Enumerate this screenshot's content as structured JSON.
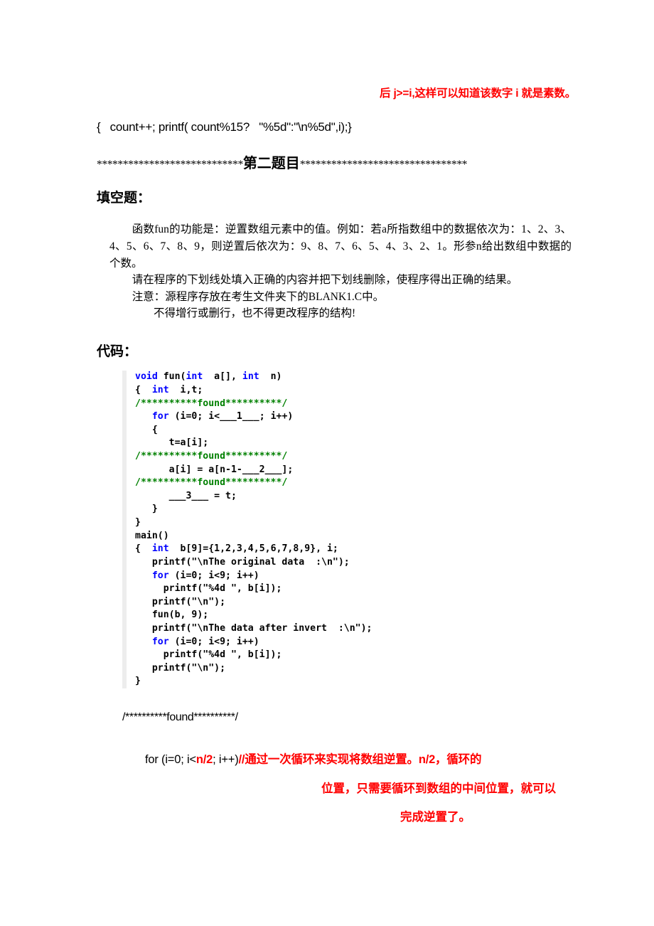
{
  "document": {
    "top_annotation": "后 j>=i,这样可以知道该数字 i 就是素数。",
    "leftover_code_line": "{   count++; printf( count%15?   \"%5d\":\"\\n%5d\",i);}",
    "divider": {
      "stars_left": "****************************",
      "title": "第二题目",
      "stars_right": "********************************"
    },
    "section_fill_heading": "填空题：",
    "description": {
      "p1": "函数fun的功能是：逆置数组元素中的值。例如：若a所指数组中的数据依次为：1、2、3、4、5、6、7、8、9，则逆置后依次为：9、8、7、6、5、4、3、2、1。形参n给出数组中数据的个数。",
      "p2": "请在程序的下划线处填入正确的内容并把下划线删除，使程序得出正确的结果。",
      "p3": "注意：源程序存放在考生文件夹下的BLANK1.C中。",
      "p4": "不得增行或删行，也不得更改程序的结构!"
    },
    "section_code_heading": "代码：",
    "code": {
      "lines": [
        [
          {
            "t": "void",
            "c": "kw"
          },
          {
            "t": " fun(",
            "c": ""
          },
          {
            "t": "int",
            "c": "kw"
          },
          {
            "t": "  a[], ",
            "c": ""
          },
          {
            "t": "int",
            "c": "kw"
          },
          {
            "t": "  n)",
            "c": ""
          }
        ],
        [
          {
            "t": "{  ",
            "c": ""
          },
          {
            "t": "int",
            "c": "kw"
          },
          {
            "t": "  i,t;",
            "c": ""
          }
        ],
        [
          {
            "t": "/**********found**********/",
            "c": "cmt"
          }
        ],
        [
          {
            "t": "   ",
            "c": ""
          },
          {
            "t": "for",
            "c": "kw"
          },
          {
            "t": " (i=0; i<___1___; i++)",
            "c": ""
          }
        ],
        [
          {
            "t": "   {",
            "c": ""
          }
        ],
        [
          {
            "t": "      t=a[i];",
            "c": ""
          }
        ],
        [
          {
            "t": "/**********found**********/",
            "c": "cmt"
          }
        ],
        [
          {
            "t": "      a[i] = a[n-1-___2___];",
            "c": ""
          }
        ],
        [
          {
            "t": "/**********found**********/",
            "c": "cmt"
          }
        ],
        [
          {
            "t": "      ___3___ = t;",
            "c": ""
          }
        ],
        [
          {
            "t": "   }",
            "c": ""
          }
        ],
        [
          {
            "t": "}",
            "c": ""
          }
        ],
        [
          {
            "t": "main()",
            "c": ""
          }
        ],
        [
          {
            "t": "{  ",
            "c": ""
          },
          {
            "t": "int",
            "c": "kw"
          },
          {
            "t": "  b[9]={1,2,3,4,5,6,7,8,9}, i;",
            "c": ""
          }
        ],
        [
          {
            "t": "   printf(\"\\nThe original data  :\\n\");",
            "c": ""
          }
        ],
        [
          {
            "t": "   ",
            "c": ""
          },
          {
            "t": "for",
            "c": "kw"
          },
          {
            "t": " (i=0; i<9; i++)",
            "c": ""
          }
        ],
        [
          {
            "t": "     printf(\"%4d \", b[i]);",
            "c": ""
          }
        ],
        [
          {
            "t": "   printf(\"\\n\");",
            "c": ""
          }
        ],
        [
          {
            "t": "   fun(b, 9);",
            "c": ""
          }
        ],
        [
          {
            "t": "   printf(\"\\nThe data after invert  :\\n\");",
            "c": ""
          }
        ],
        [
          {
            "t": "   ",
            "c": ""
          },
          {
            "t": "for",
            "c": "kw"
          },
          {
            "t": " (i=0; i<9; i++)",
            "c": ""
          }
        ],
        [
          {
            "t": "     printf(\"%4d \", b[i]);",
            "c": ""
          }
        ],
        [
          {
            "t": "   printf(\"\\n\");",
            "c": ""
          }
        ],
        [
          {
            "t": "}",
            "c": ""
          }
        ]
      ]
    },
    "answer": {
      "found_marker": "/**********found**********/",
      "code_prefix": "for (i=0; i<",
      "code_answer": "n/2",
      "code_suffix": "; i++)",
      "comment_line1": "//通过一次循环来实现将数组逆置。n/2，循环的",
      "comment_line2": "位置，只需要循环到数组的中间位置，就可以",
      "comment_line3": "完成逆置了。"
    }
  },
  "colors": {
    "accent_red": "#ff0000",
    "keyword_blue": "#0000ff",
    "comment_green": "#008000",
    "gutter_gray": "#ededed"
  }
}
